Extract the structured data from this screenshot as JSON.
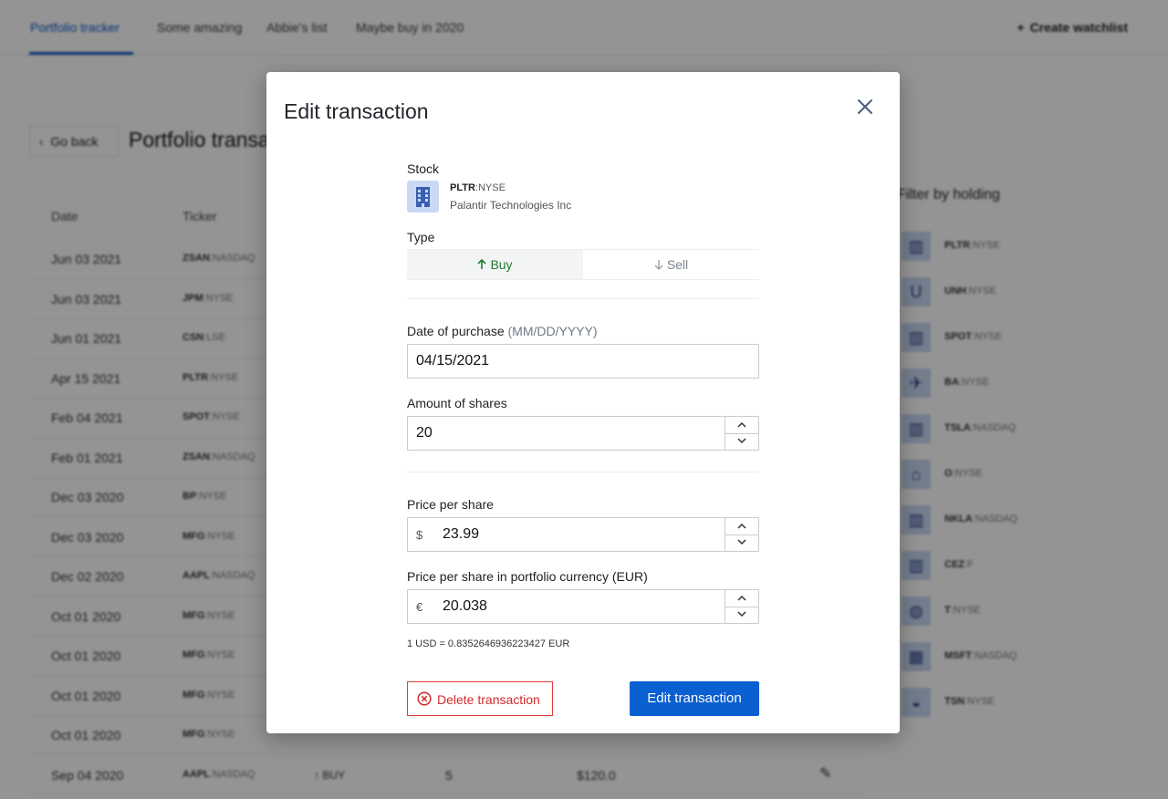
{
  "tabs": [
    {
      "label": "Portfolio tracker"
    },
    {
      "label": "Some amazing"
    },
    {
      "label": "Abbie's list"
    },
    {
      "label": "Maybe buy in 2020"
    }
  ],
  "create_watchlist": "Create watchlist",
  "go_back": "Go back",
  "page_title": "Portfolio transactions",
  "table": {
    "headers": {
      "date": "Date",
      "ticker": "Ticker"
    },
    "rows": [
      {
        "date": "Jun 03 2021",
        "symbol": "ZSAN",
        "exchange": ":NASDAQ"
      },
      {
        "date": "Jun 03 2021",
        "symbol": "JPM",
        "exchange": ":NYSE"
      },
      {
        "date": "Jun 01 2021",
        "symbol": "CSN",
        "exchange": ":LSE"
      },
      {
        "date": "Apr 15 2021",
        "symbol": "PLTR",
        "exchange": ":NYSE"
      },
      {
        "date": "Feb 04 2021",
        "symbol": "SPOT",
        "exchange": ":NYSE"
      },
      {
        "date": "Feb 01 2021",
        "symbol": "ZSAN",
        "exchange": ":NASDAQ"
      },
      {
        "date": "Dec 03 2020",
        "symbol": "BP",
        "exchange": ":NYSE"
      },
      {
        "date": "Dec 03 2020",
        "symbol": "MFG",
        "exchange": ":NYSE"
      },
      {
        "date": "Dec 02 2020",
        "symbol": "AAPL",
        "exchange": ":NASDAQ"
      },
      {
        "date": "Oct 01 2020",
        "symbol": "MFG",
        "exchange": ":NYSE"
      },
      {
        "date": "Oct 01 2020",
        "symbol": "MFG",
        "exchange": ":NYSE"
      },
      {
        "date": "Oct 01 2020",
        "symbol": "MFG",
        "exchange": ":NYSE"
      },
      {
        "date": "Oct 01 2020",
        "symbol": "MFG",
        "exchange": ":NYSE"
      },
      {
        "date": "Sep 04 2020",
        "symbol": "AAPL",
        "exchange": ":NASDAQ",
        "type": "↑ BUY",
        "amount": "5",
        "price": "$120.0"
      }
    ]
  },
  "filter": {
    "title": "Filter by holding",
    "holdings": [
      {
        "symbol": "PLTR",
        "exchange": ":NYSE",
        "logo": "▥"
      },
      {
        "symbol": "UNH",
        "exchange": ":NYSE",
        "logo": "U"
      },
      {
        "symbol": "SPOT",
        "exchange": ":NYSE",
        "logo": "▥"
      },
      {
        "symbol": "BA",
        "exchange": ":NYSE",
        "logo": "✈"
      },
      {
        "symbol": "TSLA",
        "exchange": ":NASDAQ",
        "logo": "▥"
      },
      {
        "symbol": "O",
        "exchange": ":NYSE",
        "logo": "⌂"
      },
      {
        "symbol": "NKLA",
        "exchange": ":NASDAQ",
        "logo": "▥"
      },
      {
        "symbol": "CEZ",
        "exchange": ":F",
        "logo": "▥"
      },
      {
        "symbol": "T",
        "exchange": ":NYSE",
        "logo": "◍"
      },
      {
        "symbol": "MSFT",
        "exchange": ":NASDAQ",
        "logo": "▦"
      },
      {
        "symbol": "TSN",
        "exchange": ":NYSE",
        "logo": "◒"
      }
    ]
  },
  "modal": {
    "title": "Edit transaction",
    "stock_label": "Stock",
    "stock": {
      "symbol": "PLTR",
      "exchange": ":NYSE",
      "name": "Palantir Technologies Inc"
    },
    "type_label": "Type",
    "buy_label": "Buy",
    "sell_label": "Sell",
    "date_label": "Date of purchase",
    "date_hint": "(MM/DD/YYYY)",
    "date_value": "04/15/2021",
    "amount_label": "Amount of shares",
    "amount_value": "20",
    "price_label": "Price per share",
    "price_prefix": "$",
    "price_value": "23.99",
    "price_eur_label": "Price per share in portfolio currency (EUR)",
    "price_eur_prefix": "€",
    "price_eur_value": "20.038",
    "rate_text": "1 USD = 0.8352646936223427 EUR",
    "delete_label": "Delete transaction",
    "submit_label": "Edit transaction"
  },
  "colors": {
    "primary": "#0a5fd1",
    "danger": "#d12b2b",
    "buy": "#1e7d2e"
  }
}
